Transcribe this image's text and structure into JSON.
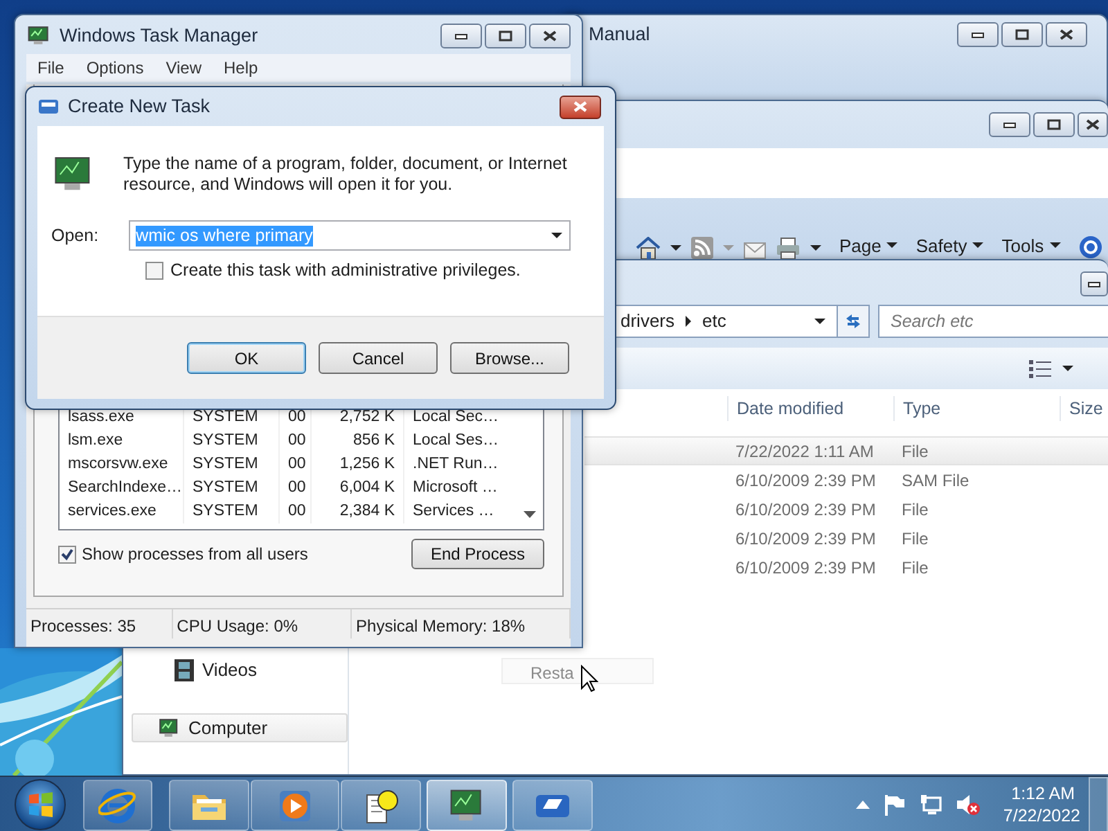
{
  "back_window": {
    "title": "Manual"
  },
  "browser_window": {
    "menus": [
      "Page",
      "Safety",
      "Tools"
    ]
  },
  "explorer_window": {
    "breadcrumb": [
      "drivers",
      "etc"
    ],
    "search": {
      "placeholder": "Search etc"
    },
    "columns": [
      "Date modified",
      "Type",
      "Size"
    ],
    "rows": [
      {
        "date": "7/22/2022 1:11 AM",
        "type": "File",
        "hovered": true
      },
      {
        "date": "6/10/2009 2:39 PM",
        "type": "SAM File",
        "hovered": false
      },
      {
        "date": "6/10/2009 2:39 PM",
        "type": "File",
        "hovered": false
      },
      {
        "date": "6/10/2009 2:39 PM",
        "type": "File",
        "hovered": false
      },
      {
        "date": "6/10/2009 2:39 PM",
        "type": "File",
        "hovered": false
      }
    ],
    "nav_items": [
      {
        "label": "Videos",
        "selected": false
      },
      {
        "label": "Computer",
        "selected": true
      }
    ],
    "faded_button": "Resta"
  },
  "task_manager": {
    "title": "Windows Task Manager",
    "menu": [
      "File",
      "Options",
      "View",
      "Help"
    ],
    "rows": [
      [
        "lsass.exe",
        "SYSTEM",
        "00",
        "2,752 K",
        "Local Sec…"
      ],
      [
        "lsm.exe",
        "SYSTEM",
        "00",
        "856 K",
        "Local Ses…"
      ],
      [
        "mscorsvw.exe",
        "SYSTEM",
        "00",
        "1,256 K",
        ".NET Run…"
      ],
      [
        "SearchIndexe…",
        "SYSTEM",
        "00",
        "6,004 K",
        "Microsoft …"
      ],
      [
        "services.exe",
        "SYSTEM",
        "00",
        "2,384 K",
        "Services …"
      ]
    ],
    "show_all": {
      "label": "Show processes from all users",
      "checked": true
    },
    "end_process": "End Process",
    "status": [
      "Processes: 35",
      "CPU Usage: 0%",
      "Physical Memory: 18%"
    ]
  },
  "dialog": {
    "title": "Create New Task",
    "message": "Type the name of a program, folder, document, or Internet resource, and Windows will open it for you.",
    "open_label": "Open:",
    "open_value": "wmic os where primary",
    "admin": {
      "label": "Create this task with administrative privileges.",
      "checked": false
    },
    "buttons": [
      {
        "label": "OK",
        "default": true
      },
      {
        "label": "Cancel",
        "default": false
      },
      {
        "label": "Browse...",
        "default": false
      }
    ]
  },
  "taskbar": {
    "buttons": [
      {
        "active": false
      },
      {
        "active": false
      },
      {
        "active": false
      },
      {
        "active": false
      },
      {
        "active": true
      },
      {
        "active": false
      }
    ],
    "time": "1:12 AM",
    "date": "7/22/2022"
  }
}
